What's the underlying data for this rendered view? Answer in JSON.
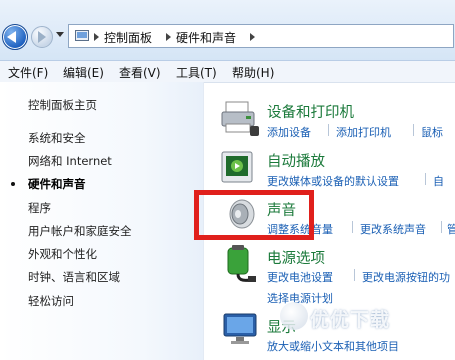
{
  "breadcrumb": [
    "控制面板",
    "硬件和声音"
  ],
  "menu": [
    "文件(F)",
    "编辑(E)",
    "查看(V)",
    "工具(T)",
    "帮助(H)"
  ],
  "left_nav": [
    {
      "label": "控制面板主页",
      "current": false
    },
    {
      "label": "系统和安全",
      "current": false
    },
    {
      "label": "网络和 Internet",
      "current": false
    },
    {
      "label": "硬件和声音",
      "current": true
    },
    {
      "label": "程序",
      "current": false
    },
    {
      "label": "用户帐户和家庭安全",
      "current": false
    },
    {
      "label": "外观和个性化",
      "current": false
    },
    {
      "label": "时钟、语言和区域",
      "current": false
    },
    {
      "label": "轻松访问",
      "current": false
    }
  ],
  "categories": {
    "devices": {
      "title": "设备和打印机",
      "links": [
        "添加设备",
        "添加打印机",
        "鼠标"
      ]
    },
    "autoplay": {
      "title": "自动播放",
      "links": [
        "更改媒体或设备的默认设置",
        "自"
      ]
    },
    "sound": {
      "title": "声音",
      "links": [
        "调整系统音量",
        "更改系统声音",
        "管"
      ]
    },
    "power": {
      "title": "电源选项",
      "links": [
        "更改电池设置",
        "更改电源按钮的功",
        "选择电源计划"
      ]
    },
    "display": {
      "title": "显示",
      "links": [
        "放大或缩小文本和其他项目"
      ]
    }
  },
  "watermark": "优优下载",
  "colors": {
    "link": "#1a5fb4",
    "title": "#1b7a3b",
    "highlight": "#e0201c"
  }
}
